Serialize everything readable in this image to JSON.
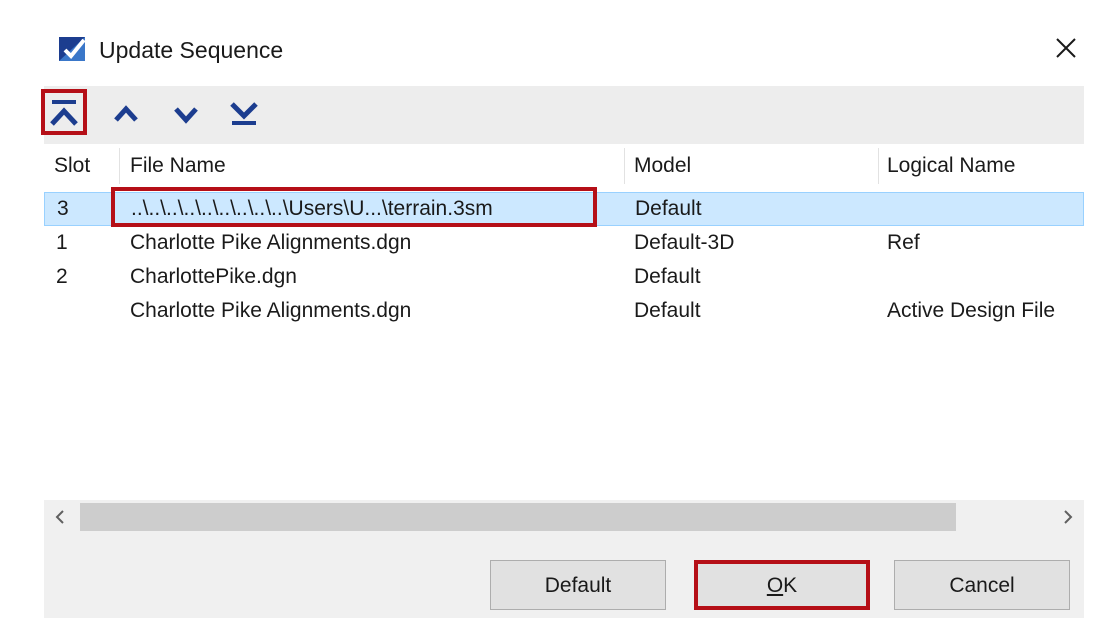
{
  "window": {
    "title": "Update Sequence",
    "app_icon": "update-sequence-icon",
    "close_icon": "close-icon"
  },
  "toolbar": {
    "buttons": [
      {
        "name": "move-to-top",
        "icon": "chevron-up-to-top-icon"
      },
      {
        "name": "move-up",
        "icon": "chevron-up-icon"
      },
      {
        "name": "move-down",
        "icon": "chevron-down-icon"
      },
      {
        "name": "move-to-bottom",
        "icon": "chevron-down-to-bottom-icon"
      }
    ]
  },
  "list": {
    "columns": [
      "Slot",
      "File Name",
      "Model",
      "Logical Name"
    ],
    "rows": [
      {
        "slot": "3",
        "file_name": "..\\..\\..\\..\\..\\..\\..\\..\\..\\Users\\U...\\terrain.3sm",
        "model": "Default",
        "logical_name": "",
        "selected": true
      },
      {
        "slot": "1",
        "file_name": "Charlotte Pike Alignments.dgn",
        "model": "Default-3D",
        "logical_name": "Ref",
        "selected": false
      },
      {
        "slot": "2",
        "file_name": "CharlottePike.dgn",
        "model": "Default",
        "logical_name": "",
        "selected": false
      },
      {
        "slot": "",
        "file_name": "Charlotte Pike Alignments.dgn",
        "model": "Default",
        "logical_name": "Active Design File",
        "selected": false
      }
    ]
  },
  "buttons": {
    "default_label": "Default",
    "ok_mnemonic": "O",
    "ok_rest": "K",
    "cancel_label": "Cancel"
  },
  "colors": {
    "accent": "#1c3d8f",
    "highlight_box": "#b50f17",
    "selection": "#cce8ff"
  }
}
